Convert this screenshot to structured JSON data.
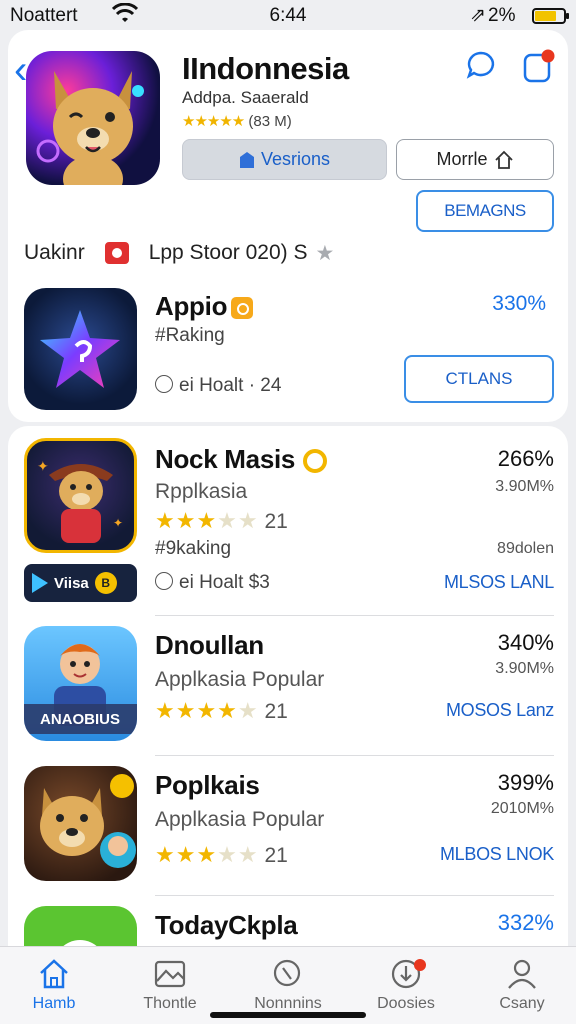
{
  "status_bar": {
    "carrier": "Noattert",
    "time": "6:44",
    "location": "⇗",
    "battery_percent": "2%",
    "battery_level": 0.75
  },
  "hero": {
    "title": "IIndonnesia",
    "subtitle": "Addpa. Saaerald",
    "stars": "★★★★★",
    "rating_count": "(83 M)",
    "versions_label": "Vesrions",
    "more_label": "Morrle",
    "primary_label": "BEMAGNS"
  },
  "ranking_row": {
    "label": "Uakinr",
    "store_text": "Lpp Stoor  020) S",
    "star": "★"
  },
  "featured": {
    "title": "Appio",
    "rank_text": "#Raking",
    "percent": "330%",
    "meta": "ei Hoalt · 24",
    "claim_label": "CTLANS"
  },
  "apps": [
    {
      "title": "Nock Masis",
      "subtitle": "Rpplkasia",
      "stars": "★★★",
      "half_star": "★★",
      "rating": "21",
      "rank_text": "#9kaking",
      "meta": "ei Hoalt   $3",
      "percent": "266%",
      "size": "3.90M%",
      "downloads": "89dolen",
      "action": "MLSOS LANL",
      "badge_label": "Viisa"
    },
    {
      "title": "Dnoullan",
      "subtitle": "Applkasia Popular",
      "stars": "★★★★",
      "half_star": "★",
      "rating": "21",
      "percent": "340%",
      "size": "3.90M%",
      "action": "MOSOS Lanz"
    },
    {
      "title": "Poplkais",
      "subtitle": "Applkasia Popular",
      "stars": "★★★",
      "half_star": "★★",
      "rating": "21",
      "percent": "399%",
      "size": "2010M%",
      "action": "MLBOS LNOK"
    },
    {
      "title": "TodayCkpla",
      "percent": "332%"
    }
  ],
  "tab_bar": [
    {
      "label": "Hamb",
      "icon": "home-icon"
    },
    {
      "label": "Thontle",
      "icon": "image-icon"
    },
    {
      "label": "Nonnnins",
      "icon": "search-icon"
    },
    {
      "label": "Doosies",
      "icon": "download-icon"
    },
    {
      "label": "Csany",
      "icon": "person-icon"
    }
  ]
}
